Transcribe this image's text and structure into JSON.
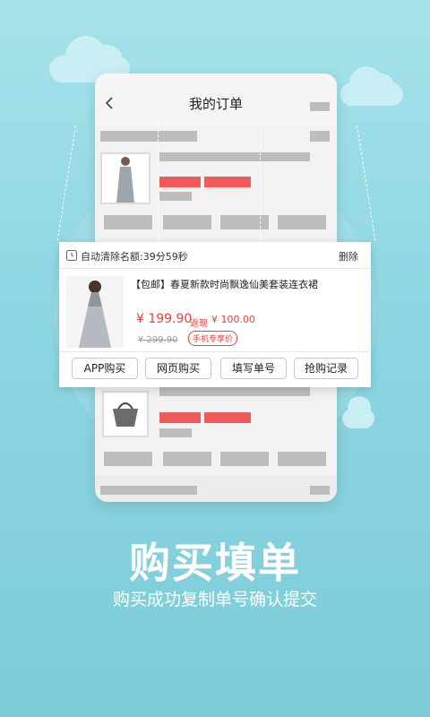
{
  "phone": {
    "title": "我的订单"
  },
  "popup": {
    "timer": "自动清除名额:39分59秒",
    "delete": "删除",
    "product_title": "【包邮】春夏新款时尚飘逸仙美套装连衣裙",
    "price": "¥ 199.90",
    "cashback_label": "返现",
    "cashback_amount": "¥ 100.00",
    "old_price": "¥ 299.90",
    "mobile_price": "手机专享价",
    "buttons": [
      "APP购买",
      "网页购买",
      "填写单号",
      "抢购记录"
    ]
  },
  "headline": "购买填单",
  "subline": "购买成功复制单号确认提交",
  "colors": {
    "accent_red": "#e8423b",
    "background": "#8dd6e2"
  },
  "icons": {
    "back": "chevron-left-icon",
    "clock": "clock-icon",
    "bag": "bag-icon"
  }
}
